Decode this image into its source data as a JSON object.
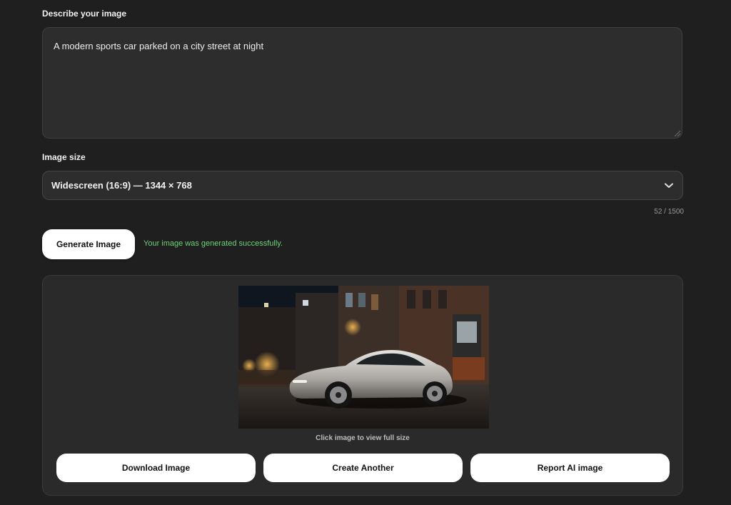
{
  "prompt": {
    "label": "Describe your image",
    "value": "A modern sports car parked on a city street at night"
  },
  "image_size": {
    "label": "Image size",
    "selected": "Widescreen (16:9) — 1344 × 768",
    "icon": "chevron-down-icon"
  },
  "counter": "52 / 1500",
  "generate": {
    "button_label": "Generate Image",
    "status": "Your image was generated successfully.",
    "status_color": "#6fd17a"
  },
  "result": {
    "caption": "Click image to view full size",
    "actions": {
      "download": "Download Image",
      "create": "Create Another",
      "report": "Report AI image"
    }
  }
}
